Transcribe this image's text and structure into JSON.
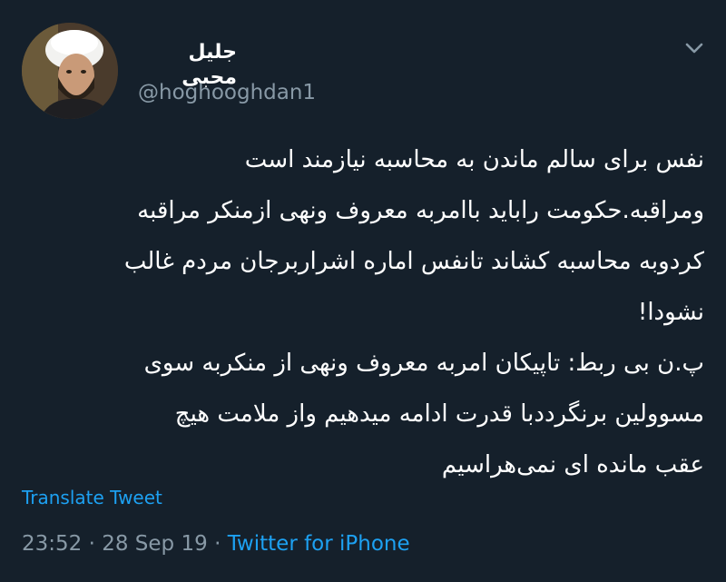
{
  "author": {
    "display_name": "جلیل محبی",
    "handle": "@hoghooghdan1"
  },
  "tweet": {
    "lines": [
      "نفس برای سالم ماندن به محاسبه نیازمند است",
      "ومراقبه.حکومت راباید باامربه معروف ونهی ازمنکر مراقبه",
      "کردوبه محاسبه کشاند تانفس اماره اشراربرجان مردم غالب",
      "نشودا!",
      "پ.ن بی ربط: تاپیکان امربه معروف ونهی از منکربه سوی",
      "مسوولین برنگرددبا قدرت ادامه میدهیم واز ملامت هیچ",
      "عقب مانده ای نمی‌هراسیم"
    ],
    "translate_label": "Translate Tweet",
    "time": "23:52",
    "separator": "·",
    "date": "28 Sep 19",
    "source": "Twitter for iPhone"
  },
  "icons": {
    "menu": "chevron-down-icon"
  },
  "colors": {
    "background": "#15202b",
    "text": "#ffffff",
    "secondary": "#8899a6",
    "link": "#1da1f2"
  }
}
